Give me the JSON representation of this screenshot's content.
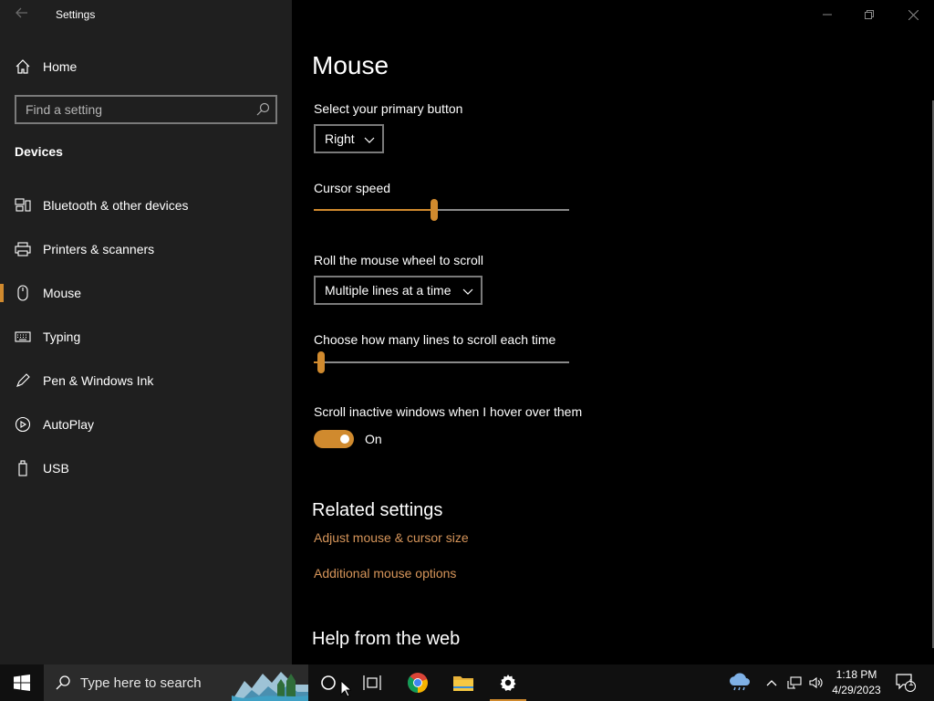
{
  "window": {
    "title": "Settings"
  },
  "sidebar": {
    "home_label": "Home",
    "search_placeholder": "Find a setting",
    "section_title": "Devices",
    "items": [
      {
        "label": "Bluetooth & other devices",
        "icon": "bluetooth-devices-icon"
      },
      {
        "label": "Printers & scanners",
        "icon": "printer-icon"
      },
      {
        "label": "Mouse",
        "icon": "mouse-icon",
        "active": true
      },
      {
        "label": "Typing",
        "icon": "keyboard-icon"
      },
      {
        "label": "Pen & Windows Ink",
        "icon": "pen-icon"
      },
      {
        "label": "AutoPlay",
        "icon": "autoplay-icon"
      },
      {
        "label": "USB",
        "icon": "usb-icon"
      }
    ]
  },
  "main": {
    "title": "Mouse",
    "primary_button": {
      "label": "Select your primary button",
      "value": "Right"
    },
    "cursor_speed": {
      "label": "Cursor speed",
      "value_fraction": 0.47
    },
    "scroll_mode": {
      "label": "Roll the mouse wheel to scroll",
      "value": "Multiple lines at a time"
    },
    "scroll_lines": {
      "label": "Choose how many lines to scroll each time",
      "value_fraction": 0.03
    },
    "inactive_scroll": {
      "label": "Scroll inactive windows when I hover over them",
      "state": "On"
    },
    "related": {
      "title": "Related settings",
      "links": [
        "Adjust mouse & cursor size",
        "Additional mouse options"
      ]
    },
    "help_title": "Help from the web"
  },
  "taskbar": {
    "search_placeholder": "Type here to search",
    "time": "1:18 PM",
    "date": "4/29/2023",
    "notification_count": "1"
  },
  "colors": {
    "accent": "#d08a2e",
    "link": "#d6955a",
    "sidebar_bg": "#1f1f1f",
    "main_bg": "#000000"
  }
}
